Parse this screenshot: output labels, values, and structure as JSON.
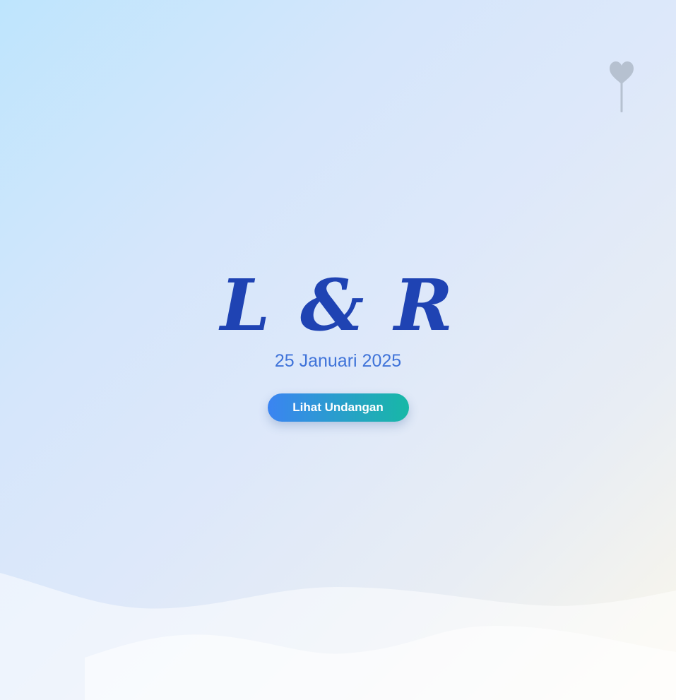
{
  "hero": {
    "monogram": "L & R",
    "date": "25 Januari 2025",
    "cta_label": "Lihat Undangan"
  },
  "decor": {
    "balloon_icon": "heart-balloon-icon",
    "balloon_color": "#b6c1d0"
  },
  "colors": {
    "monogram": "#1f43b3",
    "date": "#3f73d9",
    "button_start": "#3b84f2",
    "button_end": "#17b8a6"
  }
}
